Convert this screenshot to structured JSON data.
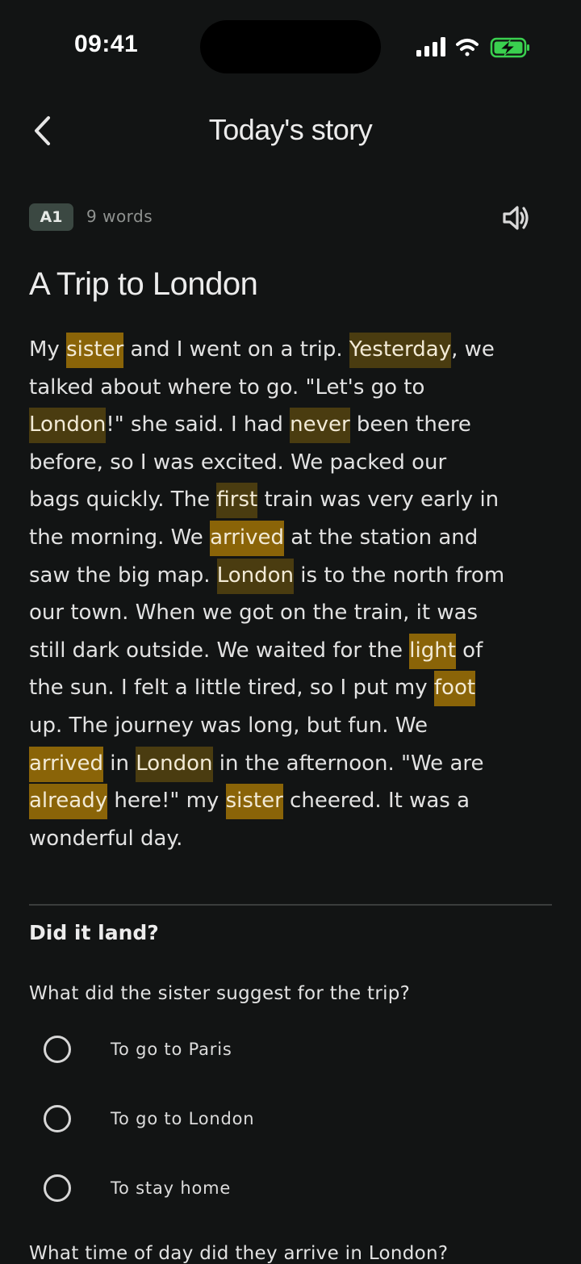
{
  "status_bar": {
    "time": "09:41"
  },
  "header": {
    "back_icon": "chevron-left-icon",
    "title": "Today's story"
  },
  "meta": {
    "level": "A1",
    "word_count": "9 words",
    "audio_icon": "speaker-icon"
  },
  "story": {
    "title": "A Trip to London",
    "lines": [
      [
        {
          "t": "My "
        },
        {
          "t": "sister",
          "h": 1
        },
        {
          "t": " and I went on a trip. "
        },
        {
          "t": "Yesterday",
          "h": 2
        },
        {
          "t": ", we"
        }
      ],
      [
        {
          "t": "talked about where to go. \"Let's go to"
        }
      ],
      [
        {
          "t": "London",
          "h": 2
        },
        {
          "t": "!\" she said. I had "
        },
        {
          "t": "never",
          "h": 2
        },
        {
          "t": " been there"
        }
      ],
      [
        {
          "t": "before, so I was excited. We packed our"
        }
      ],
      [
        {
          "t": "bags quickly. The "
        },
        {
          "t": "first",
          "h": 2
        },
        {
          "t": " train was very early in"
        }
      ],
      [
        {
          "t": "the morning. We "
        },
        {
          "t": "arrived",
          "h": 1
        },
        {
          "t": " at the station and"
        }
      ],
      [
        {
          "t": "saw the big map. "
        },
        {
          "t": "London",
          "h": 2
        },
        {
          "t": " is to the north from"
        }
      ],
      [
        {
          "t": "our town. When we got on the train, it was"
        }
      ],
      [
        {
          "t": "still dark outside. We waited for the "
        },
        {
          "t": "light",
          "h": 1
        },
        {
          "t": " of"
        }
      ],
      [
        {
          "t": "the sun. I felt a little tired, so I put my "
        },
        {
          "t": "foot",
          "h": 1
        }
      ],
      [
        {
          "t": "up. The journey was long, but fun. We"
        }
      ],
      [
        {
          "t": "arrived",
          "h": 1
        },
        {
          "t": " in "
        },
        {
          "t": "London",
          "h": 2
        },
        {
          "t": " in the afternoon. \"We are"
        }
      ],
      [
        {
          "t": "already",
          "h": 1
        },
        {
          "t": " here!\" my "
        },
        {
          "t": "sister",
          "h": 1
        },
        {
          "t": " cheered. It was a"
        }
      ],
      [
        {
          "t": "wonderful day."
        }
      ]
    ]
  },
  "quiz": {
    "heading": "Did it land?",
    "questions": [
      {
        "text": "What did the sister suggest for the trip?",
        "options": [
          "To go to Paris",
          "To go to London",
          "To stay home"
        ]
      },
      {
        "text": "What time of day did they arrive in London?"
      }
    ]
  },
  "colors": {
    "background": "#121414",
    "highlight": "#8a6408",
    "highlight_dim": "#4a3c10",
    "badge": "#3b4842",
    "battery": "#3ad04f"
  }
}
